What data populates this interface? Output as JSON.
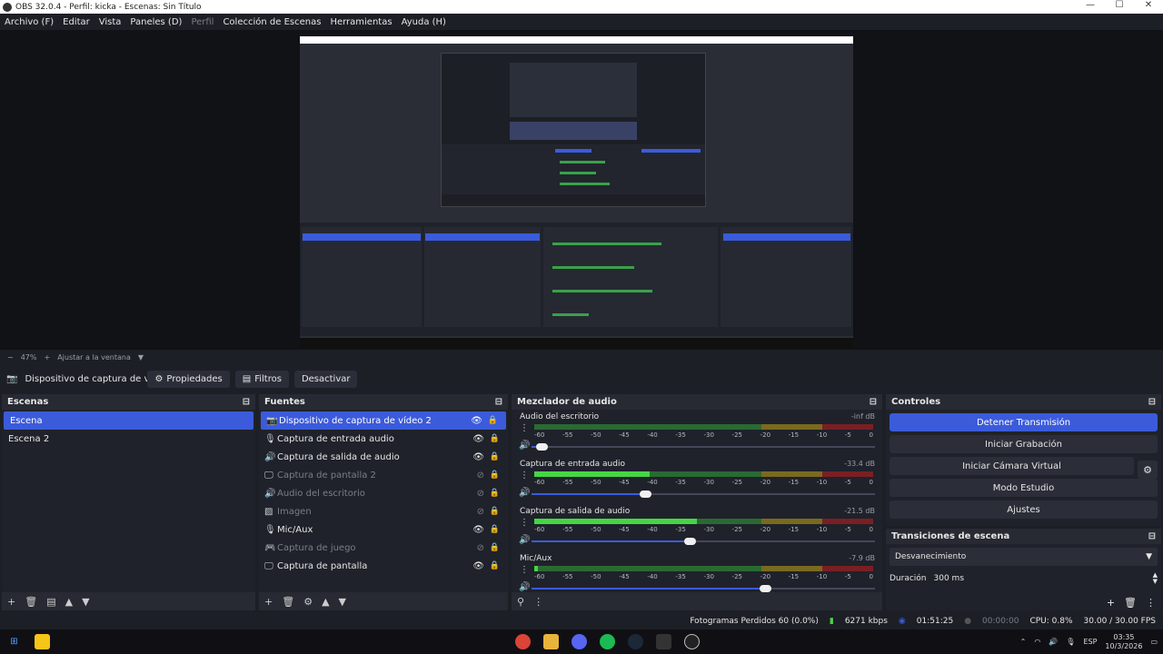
{
  "window": {
    "title": "OBS 32.0.4 - Perfil: kicka - Escenas: Sin Título",
    "minimize_glyph": "—",
    "maximize_glyph": "☐",
    "close_glyph": "✕"
  },
  "menu": [
    "Archivo (F)",
    "Editar",
    "Vista",
    "Paneles (D)",
    "Perfil",
    "Colección de Escenas",
    "Herramientas",
    "Ayuda (H)"
  ],
  "zoom": {
    "minus": "−",
    "level": "47%",
    "plus": "+",
    "fit_label": "Ajustar a la ventana"
  },
  "toolbar": {
    "source_name": "Dispositivo de captura de v",
    "properties": "Propiedades",
    "filters": "Filtros",
    "deactivate": "Desactivar"
  },
  "scenes": {
    "title": "Escenas",
    "items": [
      "Escena",
      "Escena 2"
    ]
  },
  "sources": {
    "title": "Fuentes",
    "items": [
      {
        "label": "Dispositivo de captura de vídeo 2",
        "icon": "camera-icon",
        "glyph": "📷",
        "visible": true,
        "selected": true
      },
      {
        "label": "Captura de entrada audio",
        "icon": "mic-icon",
        "glyph": "🎙",
        "visible": true,
        "selected": false
      },
      {
        "label": "Captura de salida de audio",
        "icon": "speaker-icon",
        "glyph": "🔊",
        "visible": true,
        "selected": false
      },
      {
        "label": "Captura de pantalla 2",
        "icon": "monitor-icon",
        "glyph": "🖵",
        "visible": false,
        "selected": false
      },
      {
        "label": "Audio del escritorio",
        "icon": "speaker-icon",
        "glyph": "🔊",
        "visible": false,
        "selected": false
      },
      {
        "label": "Imagen",
        "icon": "image-icon",
        "glyph": "▨",
        "visible": false,
        "selected": false
      },
      {
        "label": "Mic/Aux",
        "icon": "mic-icon",
        "glyph": "🎙",
        "visible": true,
        "selected": false
      },
      {
        "label": "Captura de juego",
        "icon": "gamepad-icon",
        "glyph": "🎮",
        "visible": false,
        "selected": false
      },
      {
        "label": "Captura de pantalla",
        "icon": "monitor-icon",
        "glyph": "🖵",
        "visible": true,
        "selected": false
      }
    ]
  },
  "mixer": {
    "title": "Mezclador de audio",
    "ticks": [
      "-60",
      "-55",
      "-50",
      "-45",
      "-40",
      "-35",
      "-30",
      "-25",
      "-20",
      "-15",
      "-10",
      "-5",
      "0"
    ],
    "channels": [
      {
        "name": "Audio del escritorio",
        "db": "-inf dB",
        "level": 0.0,
        "volume": 0.03
      },
      {
        "name": "Captura de entrada audio",
        "db": "-33.4 dB",
        "level": 0.34,
        "volume": 0.33
      },
      {
        "name": "Captura de salida de audio",
        "db": "-21.5 dB",
        "level": 0.48,
        "volume": 0.46
      },
      {
        "name": "Mic/Aux",
        "db": "-7.9 dB",
        "level": 0.01,
        "volume": 0.68
      }
    ]
  },
  "controls": {
    "title": "Controles",
    "stop_stream": "Detener Transmisión",
    "start_recording": "Iniciar Grabación",
    "start_virtual_cam": "Iniciar Cámara Virtual",
    "studio_mode": "Modo Estudio",
    "settings": "Ajustes"
  },
  "transitions": {
    "title": "Transiciones de escena",
    "current": "Desvanecimiento",
    "duration_label": "Duración",
    "duration_value": "300 ms"
  },
  "status": {
    "dropped_frames": "Fotogramas Perdidos 60 (0.0%)",
    "bitrate": "6271 kbps",
    "stream_time": "01:51:25",
    "rec_time": "00:00:00",
    "cpu": "CPU: 0.8%",
    "fps": "30.00 / 30.00 FPS"
  },
  "taskbar": {
    "lang": "ESP",
    "time": "03:35",
    "date": "10/3/2026"
  },
  "colors": {
    "accent": "#3b5bdb",
    "meter_green": "#45d645",
    "meter_yellow": "#7a6a1f",
    "meter_red": "#7a1f24"
  }
}
